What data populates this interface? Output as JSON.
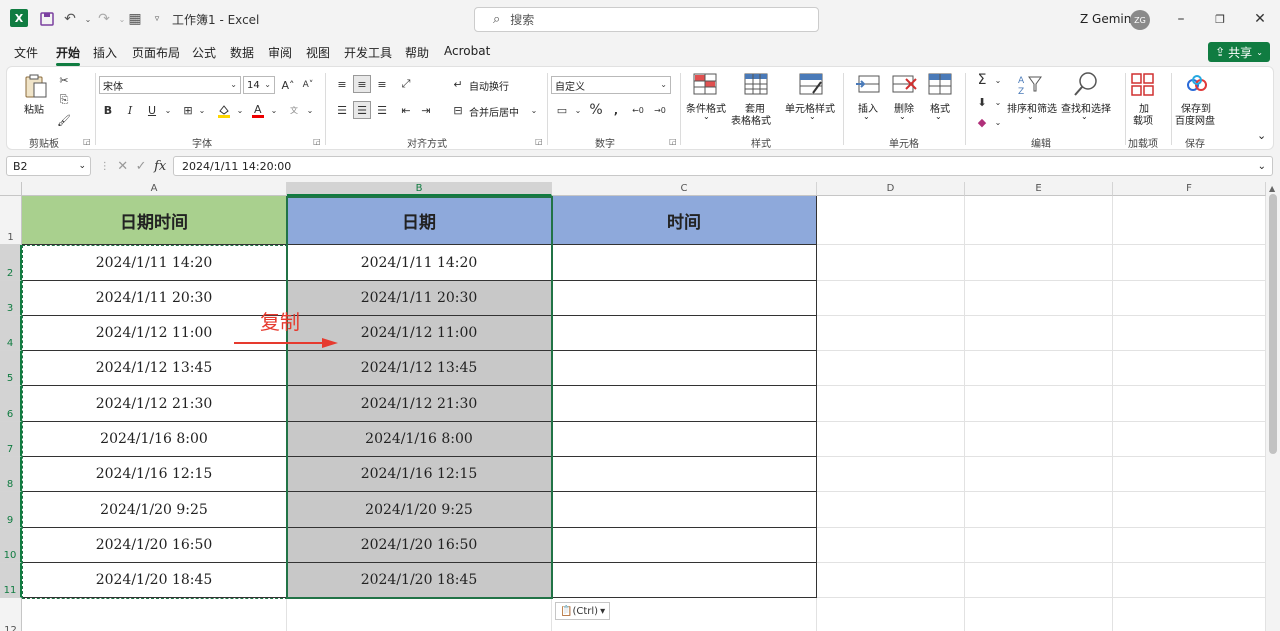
{
  "titlebar": {
    "app_icon": "X",
    "doc_title": "工作簿1  -  Excel",
    "search_placeholder": "搜索",
    "user_name": "Z Gemini",
    "avatar_initials": "ZG",
    "icons": [
      "save-icon",
      "undo-icon",
      "redo-icon",
      "form-icon",
      "customize-icon"
    ]
  },
  "menu": {
    "tabs": [
      "文件",
      "开始",
      "插入",
      "页面布局",
      "公式",
      "数据",
      "审阅",
      "视图",
      "开发工具",
      "帮助",
      "Acrobat"
    ],
    "active": "开始",
    "share_label": "共享"
  },
  "ribbon": {
    "clipboard": {
      "paste": "粘贴",
      "group": "剪贴板"
    },
    "font": {
      "name": "宋体",
      "size": "14",
      "bold": "B",
      "italic": "I",
      "underline": "U",
      "group": "字体"
    },
    "alignment": {
      "wrap": "自动换行",
      "merge": "合并后居中",
      "group": "对齐方式"
    },
    "number": {
      "format": "自定义",
      "percent": "%",
      "group": "数字"
    },
    "styles": {
      "conditional": "条件格式",
      "table_fmt_1": "套用",
      "table_fmt_2": "表格格式",
      "cell_styles": "单元格样式",
      "group": "样式"
    },
    "cells": {
      "insert": "插入",
      "delete": "删除",
      "format": "格式",
      "group": "单元格"
    },
    "editing": {
      "sort": "排序和筛选",
      "find": "查找和选择",
      "group": "编辑"
    },
    "addins": {
      "label_1": "加",
      "label_2": "载项",
      "group": "加载项"
    },
    "save": {
      "label_1": "保存到",
      "label_2": "百度网盘",
      "group": "保存"
    }
  },
  "formula_bar": {
    "name_box": "B2",
    "fx": "fx",
    "content": "2024/1/11  14:20:00"
  },
  "sheet": {
    "columns": [
      "A",
      "B",
      "C",
      "D",
      "E",
      "F"
    ],
    "rows": [
      "1",
      "2",
      "3",
      "4",
      "5",
      "6",
      "7",
      "8",
      "9",
      "10",
      "11",
      "12"
    ],
    "headers": {
      "A": "日期时间",
      "B": "日期",
      "C": "时间"
    },
    "header_colors": {
      "A": "#a9d08e",
      "B": "#8ea9db",
      "C": "#8ea9db"
    },
    "col_a": [
      "2024/1/11  14:20",
      "2024/1/11  20:30",
      "2024/1/12  11:00",
      "2024/1/12  13:45",
      "2024/1/12  21:30",
      "2024/1/16  8:00",
      "2024/1/16  12:15",
      "2024/1/20  9:25",
      "2024/1/20  16:50",
      "2024/1/20  18:45"
    ],
    "col_b": [
      "2024/1/11  14:20",
      "2024/1/11  20:30",
      "2024/1/12  11:00",
      "2024/1/12  13:45",
      "2024/1/12  21:30",
      "2024/1/16  8:00",
      "2024/1/16  12:15",
      "2024/1/20  9:25",
      "2024/1/20  16:50",
      "2024/1/20  18:45"
    ],
    "selection_fill": "#c8c8c8",
    "accent": "#217346"
  },
  "annotation": {
    "text": "复制",
    "color": "#e63a2e"
  },
  "paste_options": "(Ctrl)"
}
